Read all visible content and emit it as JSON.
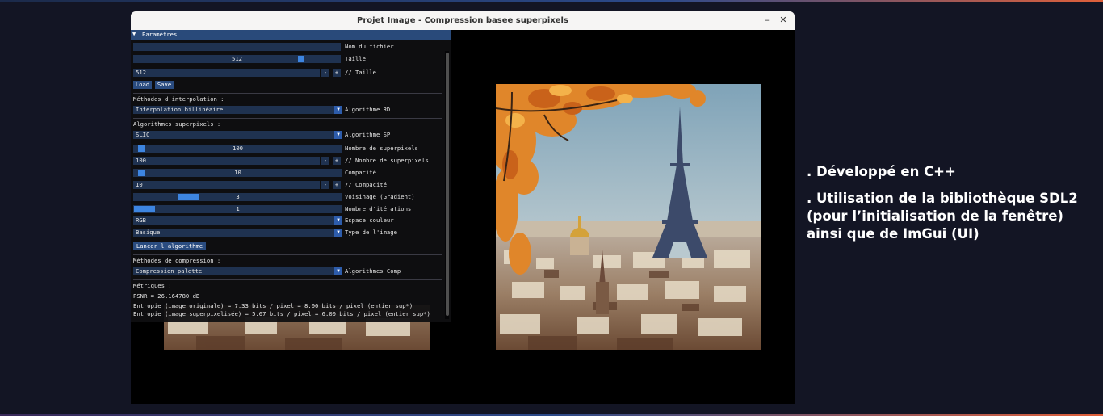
{
  "window": {
    "title": "Projet Image - Compression basee superpixels",
    "minimize_glyph": "–",
    "close_glyph": "✕"
  },
  "panel": {
    "header": "Paramètres",
    "filename": {
      "value": "",
      "label": "Nom du fichier"
    },
    "taille_slider": {
      "value": "512",
      "fraction": 0.82,
      "label": "Taille"
    },
    "taille_input": {
      "value": "512",
      "label": "// Taille"
    },
    "load_label": "Load",
    "save_label": "Save",
    "interp_section": "Méthodes d'interpolation :",
    "interp_combo": {
      "value": "Interpolation billinéaire",
      "label": "Algorithme RD"
    },
    "sp_section": "Algorithmes superpixels :",
    "sp_combo": {
      "value": "SLIC",
      "label": "Algorithme SP"
    },
    "nb_sp_slider": {
      "value": "100",
      "fraction": 0.02,
      "label": "Nombre de superpixels"
    },
    "nb_sp_input": {
      "value": "100",
      "label": "// Nombre de superpixels"
    },
    "compacite_slider": {
      "value": "10",
      "fraction": 0.02,
      "label": "Compacité"
    },
    "compacite_input": {
      "value": "10",
      "label": "// Compacité"
    },
    "voisinage_slider": {
      "value": "3",
      "fraction": 0.24,
      "label": "Voisinage (Gradient)"
    },
    "iter_slider": {
      "value": "1",
      "fraction": 0.0,
      "label": "Nombre d'itérations"
    },
    "color_combo": {
      "value": "RGB",
      "label": "Espace couleur"
    },
    "type_combo": {
      "value": "Basique",
      "label": "Type de l'image"
    },
    "run_label": "Lancer l'algorithme",
    "comp_section": "Méthodes de compression :",
    "comp_combo": {
      "value": "Compression palette",
      "label": "Algorithmes Comp"
    },
    "metrics_title": "Métriques :",
    "psnr": "PSNR = 26.164780 dB",
    "entropy_orig": "Entropie (image originale) = 7.33 bits / pixel = 8.00 bits / pixel (entier sup*)",
    "entropy_sp": "Entropie (image superpixelisée) = 5.67 bits / pixel = 6.00 bits / pixel (entier sup*)",
    "minus": "-",
    "plus": "+",
    "combo_arrow": "▼",
    "collapse_arrow": "▼"
  },
  "side_notes": [
    ". Développé en C++",
    ". Utilisation de la bibliothèque SDL2 (pour l’initialisation de la fenêtre) ainsi que de ImGui (UI)"
  ],
  "colors": {
    "background": "#131524",
    "imgui_header": "#294a7a",
    "imgui_frame": "#1f3250",
    "imgui_accent": "#3d85e0"
  }
}
